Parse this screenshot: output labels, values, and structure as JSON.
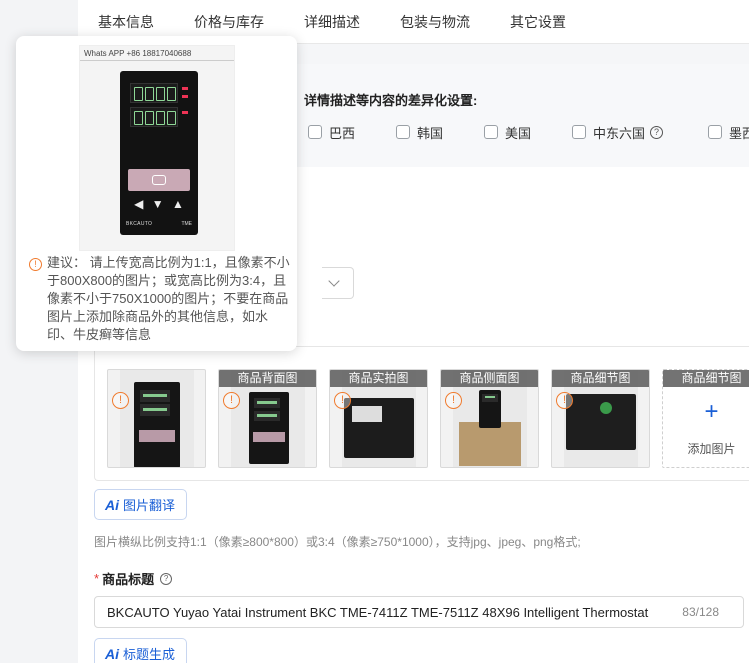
{
  "tabs": [
    {
      "label": "基本信息"
    },
    {
      "label": "价格与库存"
    },
    {
      "label": "详细描述"
    },
    {
      "label": "包装与物流"
    },
    {
      "label": "其它设置"
    }
  ],
  "diff_settings": {
    "title": "详情描述等内容的差异化设置:",
    "options": [
      {
        "label": "巴西"
      },
      {
        "label": "韩国"
      },
      {
        "label": "美国"
      },
      {
        "label": "中东六国"
      },
      {
        "label": "墨西"
      }
    ]
  },
  "popover": {
    "watermark": "Whats APP +86 18817040688",
    "brand": "BKCAUTO",
    "model": "TME",
    "note": "建议： 请上传宽高比例为1:1，且像素不小于800X800的图片；或宽高比例为3:4，且像素不小于750X1000的图片；不要在商品图片上添加除商品外的其他信息，如水印、牛皮癣等信息"
  },
  "image_slots": [
    {
      "tag": "",
      "icon": "warning-icon"
    },
    {
      "tag": "商品背面图",
      "icon": "warning-icon"
    },
    {
      "tag": "商品实拍图",
      "icon": "warning-icon"
    },
    {
      "tag": "商品侧面图",
      "icon": "warning-icon"
    },
    {
      "tag": "商品细节图",
      "icon": "warning-icon"
    },
    {
      "tag": "商品细节图",
      "add_label": "添加图片",
      "plus": "+"
    }
  ],
  "translate_button": {
    "ai": "Ai",
    "label": "图片翻译"
  },
  "image_hint": "图片横纵比例支持1:1（像素≥800*800）或3:4（像素≥750*1000），支持jpg、jpeg、png格式;",
  "product_title": {
    "required_mark": "*",
    "label": "商品标题",
    "value": "BKCAUTO Yuyao Yatai Instrument BKC TME-7411Z TME-7511Z 48X96 Intelligent Thermostat",
    "count": "83/128"
  },
  "generate_button": {
    "ai": "Ai",
    "label": "标题生成"
  },
  "colors": {
    "accent": "#1a5fd6",
    "warning": "#f07b2e",
    "required": "#e53935"
  }
}
